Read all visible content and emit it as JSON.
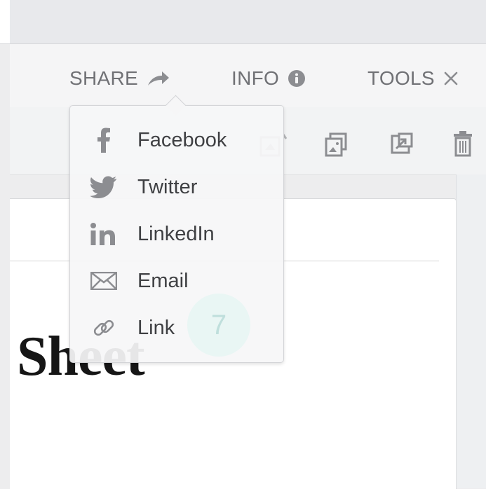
{
  "header": {
    "share_label": "SHARE",
    "info_label": "INFO",
    "tools_label": "TOOLS"
  },
  "share_menu": {
    "items": [
      {
        "label": "Facebook",
        "icon": "facebook-icon"
      },
      {
        "label": "Twitter",
        "icon": "twitter-icon"
      },
      {
        "label": "LinkedIn",
        "icon": "linkedin-icon"
      },
      {
        "label": "Email",
        "icon": "envelope-icon"
      },
      {
        "label": "Link",
        "icon": "link-icon"
      }
    ]
  },
  "toolbar": {
    "icons": [
      "copy-icon",
      "duplicate-icon",
      "external-open-icon",
      "trash-icon"
    ]
  },
  "document": {
    "title_fragment": "Sheet"
  },
  "badge": {
    "count": "7"
  },
  "colors": {
    "text_gray": "#707175",
    "menu_text": "#3f4043",
    "icon_gray": "#9a9b9f"
  }
}
